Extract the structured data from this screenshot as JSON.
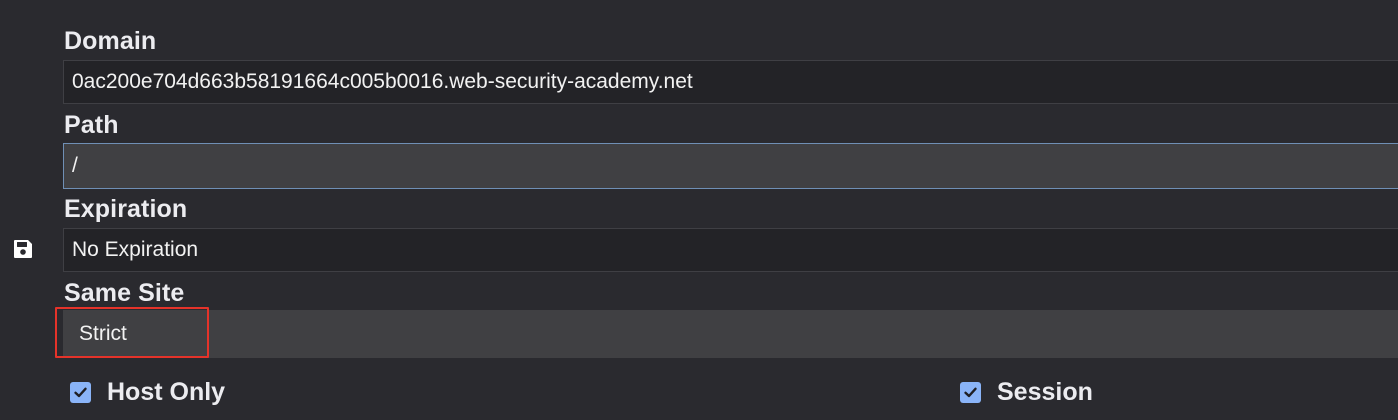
{
  "cookie_editor": {
    "save_icon": "save-icon",
    "fields": {
      "domain": {
        "label": "Domain",
        "value": "0ac200e704d663b58191664c005b0016.web-security-academy.net"
      },
      "path": {
        "label": "Path",
        "value": "/"
      },
      "expiration": {
        "label": "Expiration",
        "value": "No Expiration"
      },
      "same_site": {
        "label": "Same Site",
        "value": "Strict"
      }
    },
    "checkboxes": {
      "host_only": {
        "label": "Host Only",
        "checked": true
      },
      "session": {
        "label": "Session",
        "checked": true
      }
    },
    "colors": {
      "background": "#2a2a2f",
      "checkbox": "#8ab4f8",
      "highlight": "#e5332a",
      "active_border": "#6f8fb5"
    }
  }
}
